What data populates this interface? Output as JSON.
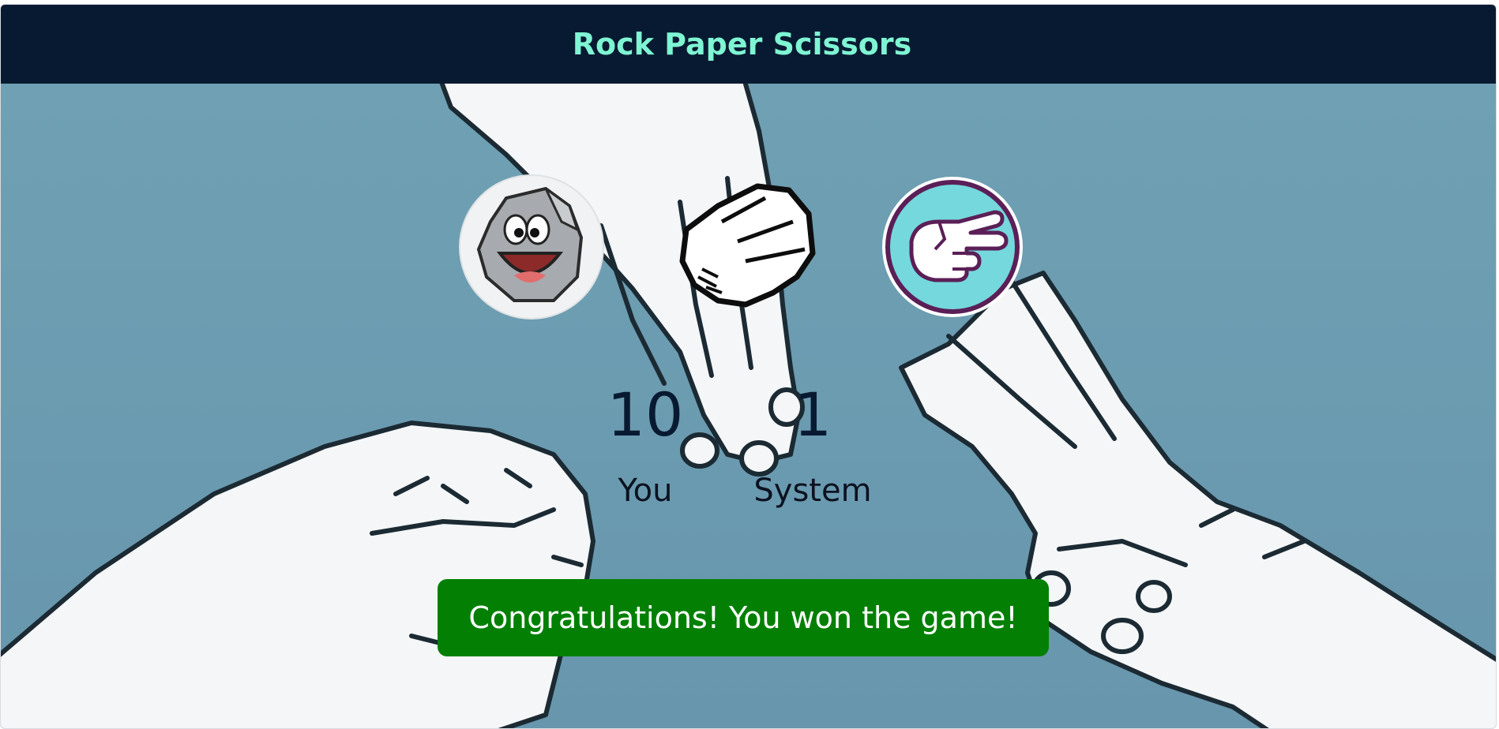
{
  "app": {
    "title": "Rock Paper Scissors"
  },
  "choices": [
    {
      "name": "rock",
      "icon": "cartoon-rock-icon"
    },
    {
      "name": "paper",
      "icon": "open-hand-icon"
    },
    {
      "name": "scissors",
      "icon": "scissors-hand-icon"
    }
  ],
  "scores": {
    "you": {
      "value": "10",
      "label": "You"
    },
    "system": {
      "value": "1",
      "label": "System"
    }
  },
  "result": {
    "message": "Congratulations! You won the game!",
    "color": "#038003"
  },
  "colors": {
    "header_bg": "#081a31",
    "title": "#7ff5d3",
    "background": "#6fa0b3"
  }
}
